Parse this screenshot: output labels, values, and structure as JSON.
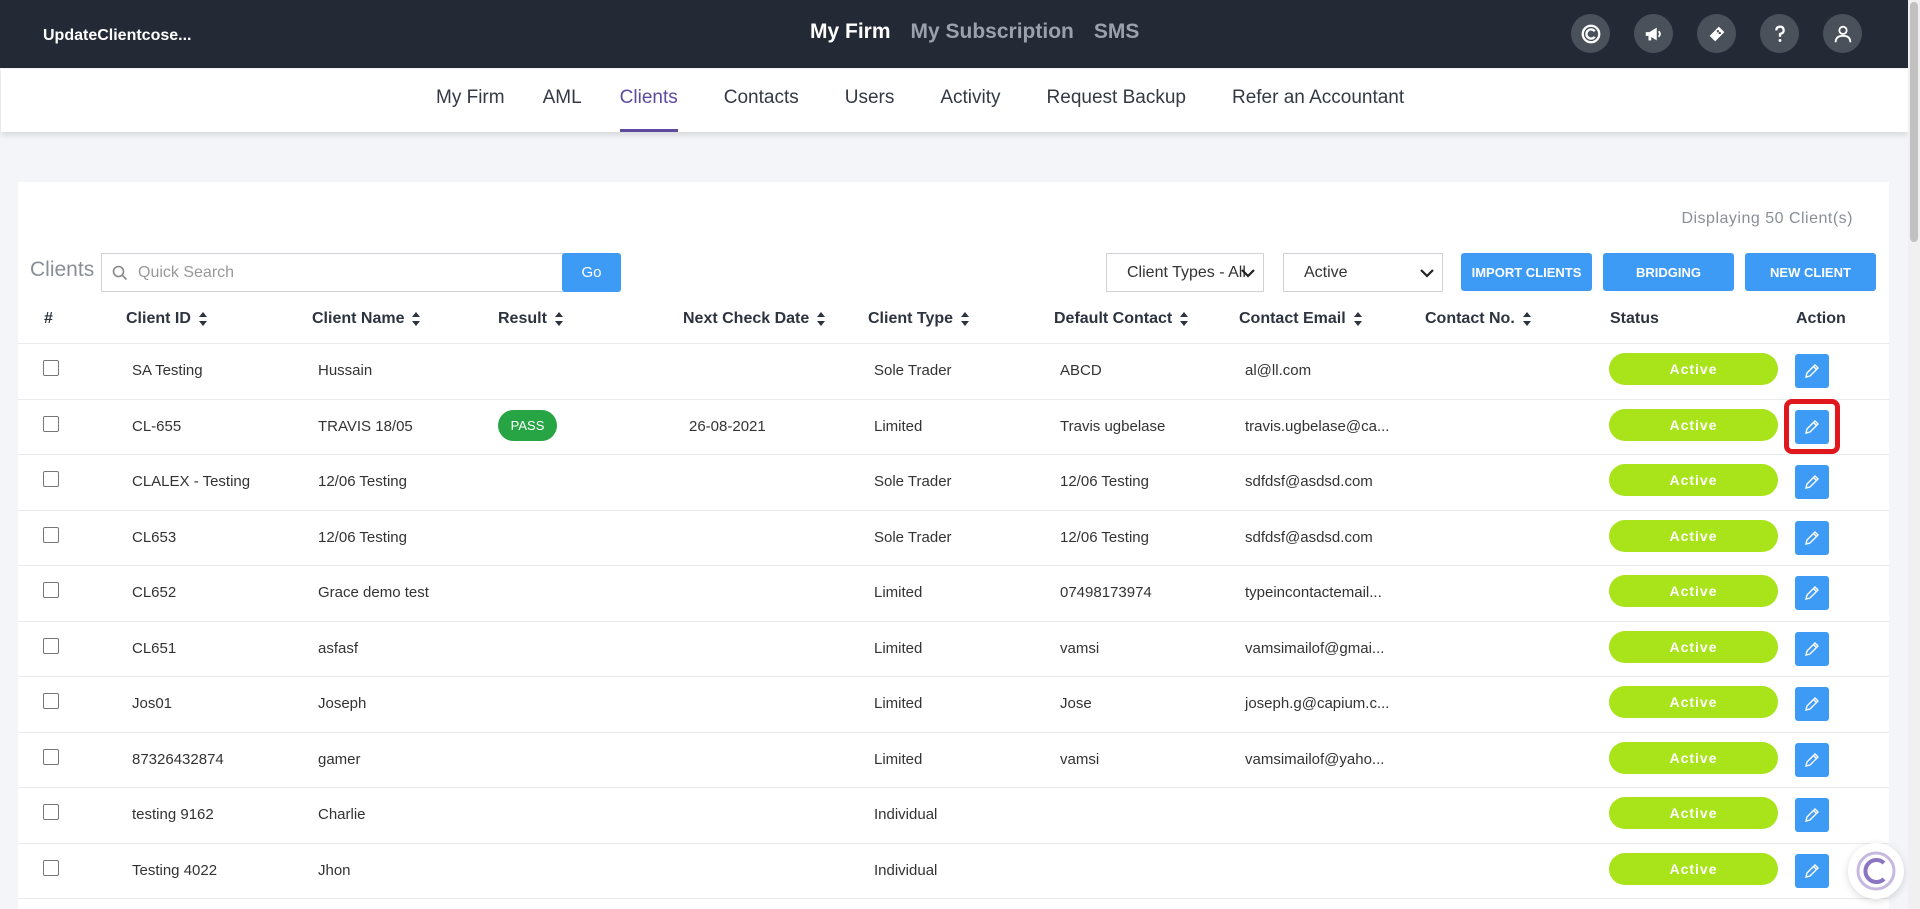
{
  "header": {
    "brand": "UpdateClientcose...",
    "nav": [
      "My Firm",
      "My Subscription",
      "SMS"
    ],
    "active_nav": "My Firm",
    "icons": [
      "capium-logo-icon",
      "megaphone-icon",
      "ticket-icon",
      "help-icon",
      "user-icon"
    ]
  },
  "subnav": {
    "items": [
      "My Firm",
      "AML",
      "Clients",
      "Contacts",
      "Users",
      "Activity",
      "Request Backup",
      "Refer an Accountant"
    ],
    "active": "Clients"
  },
  "toolbar": {
    "displaying": "Displaying 50 Client(s)",
    "clients_label": "Clients",
    "search_placeholder": "Quick Search",
    "go_label": "Go",
    "client_types_value": "Client Types - All",
    "status_value": "Active",
    "import_label": "IMPORT CLIENTS",
    "bridging_label": "BRIDGING",
    "new_client_label": "NEW CLIENT"
  },
  "table": {
    "headers": {
      "hash": "#",
      "client_id": "Client ID",
      "client_name": "Client Name",
      "result": "Result",
      "next_check": "Next Check Date",
      "client_type": "Client Type",
      "default_contact": "Default Contact",
      "contact_email": "Contact Email",
      "contact_no": "Contact No.",
      "status": "Status",
      "action": "Action"
    },
    "rows": [
      {
        "client_id": "SA Testing",
        "client_name": "Hussain",
        "result": "",
        "next_check": "",
        "client_type": "Sole Trader",
        "default_contact": "ABCD",
        "contact_email": "al@ll.com",
        "contact_no": "",
        "status": "Active"
      },
      {
        "client_id": "CL-655",
        "client_name": "TRAVIS 18/05",
        "result": "PASS",
        "next_check": "26-08-2021",
        "client_type": "Limited",
        "default_contact": "Travis ugbelase",
        "contact_email": "travis.ugbelase@ca...",
        "contact_no": "",
        "status": "Active"
      },
      {
        "client_id": "CLALEX - Testing",
        "client_name": "12/06 Testing",
        "result": "",
        "next_check": "",
        "client_type": "Sole Trader",
        "default_contact": "12/06 Testing",
        "contact_email": "sdfdsf@asdsd.com",
        "contact_no": "",
        "status": "Active"
      },
      {
        "client_id": "CL653",
        "client_name": "12/06 Testing",
        "result": "",
        "next_check": "",
        "client_type": "Sole Trader",
        "default_contact": "12/06 Testing",
        "contact_email": "sdfdsf@asdsd.com",
        "contact_no": "",
        "status": "Active"
      },
      {
        "client_id": "CL652",
        "client_name": "Grace demo test",
        "result": "",
        "next_check": "",
        "client_type": "Limited",
        "default_contact": "07498173974",
        "contact_email": "typeincontactemail...",
        "contact_no": "",
        "status": "Active"
      },
      {
        "client_id": "CL651",
        "client_name": "asfasf",
        "result": "",
        "next_check": "",
        "client_type": "Limited",
        "default_contact": "vamsi",
        "contact_email": "vamsimailof@gmai...",
        "contact_no": "",
        "status": "Active"
      },
      {
        "client_id": "Jos01",
        "client_name": "Joseph",
        "result": "",
        "next_check": "",
        "client_type": "Limited",
        "default_contact": "Jose",
        "contact_email": "joseph.g@capium.c...",
        "contact_no": "",
        "status": "Active"
      },
      {
        "client_id": "87326432874",
        "client_name": "gamer",
        "result": "",
        "next_check": "",
        "client_type": "Limited",
        "default_contact": "vamsi",
        "contact_email": "vamsimailof@yaho...",
        "contact_no": "",
        "status": "Active"
      },
      {
        "client_id": "testing 9162",
        "client_name": "Charlie",
        "result": "",
        "next_check": "",
        "client_type": "Individual",
        "default_contact": "",
        "contact_email": "",
        "contact_no": "",
        "status": "Active"
      },
      {
        "client_id": "Testing 4022",
        "client_name": "Jhon",
        "result": "",
        "next_check": "",
        "client_type": "Individual",
        "default_contact": "",
        "contact_email": "",
        "contact_no": "",
        "status": "Active"
      }
    ],
    "highlighted_row": 1
  },
  "colors": {
    "topbar": "#232a35",
    "accent": "#5e4a9e",
    "button_blue": "#3d9bf5",
    "status_green": "#a9e41b",
    "pass_green": "#27a544",
    "highlight_red": "#e0171d"
  }
}
